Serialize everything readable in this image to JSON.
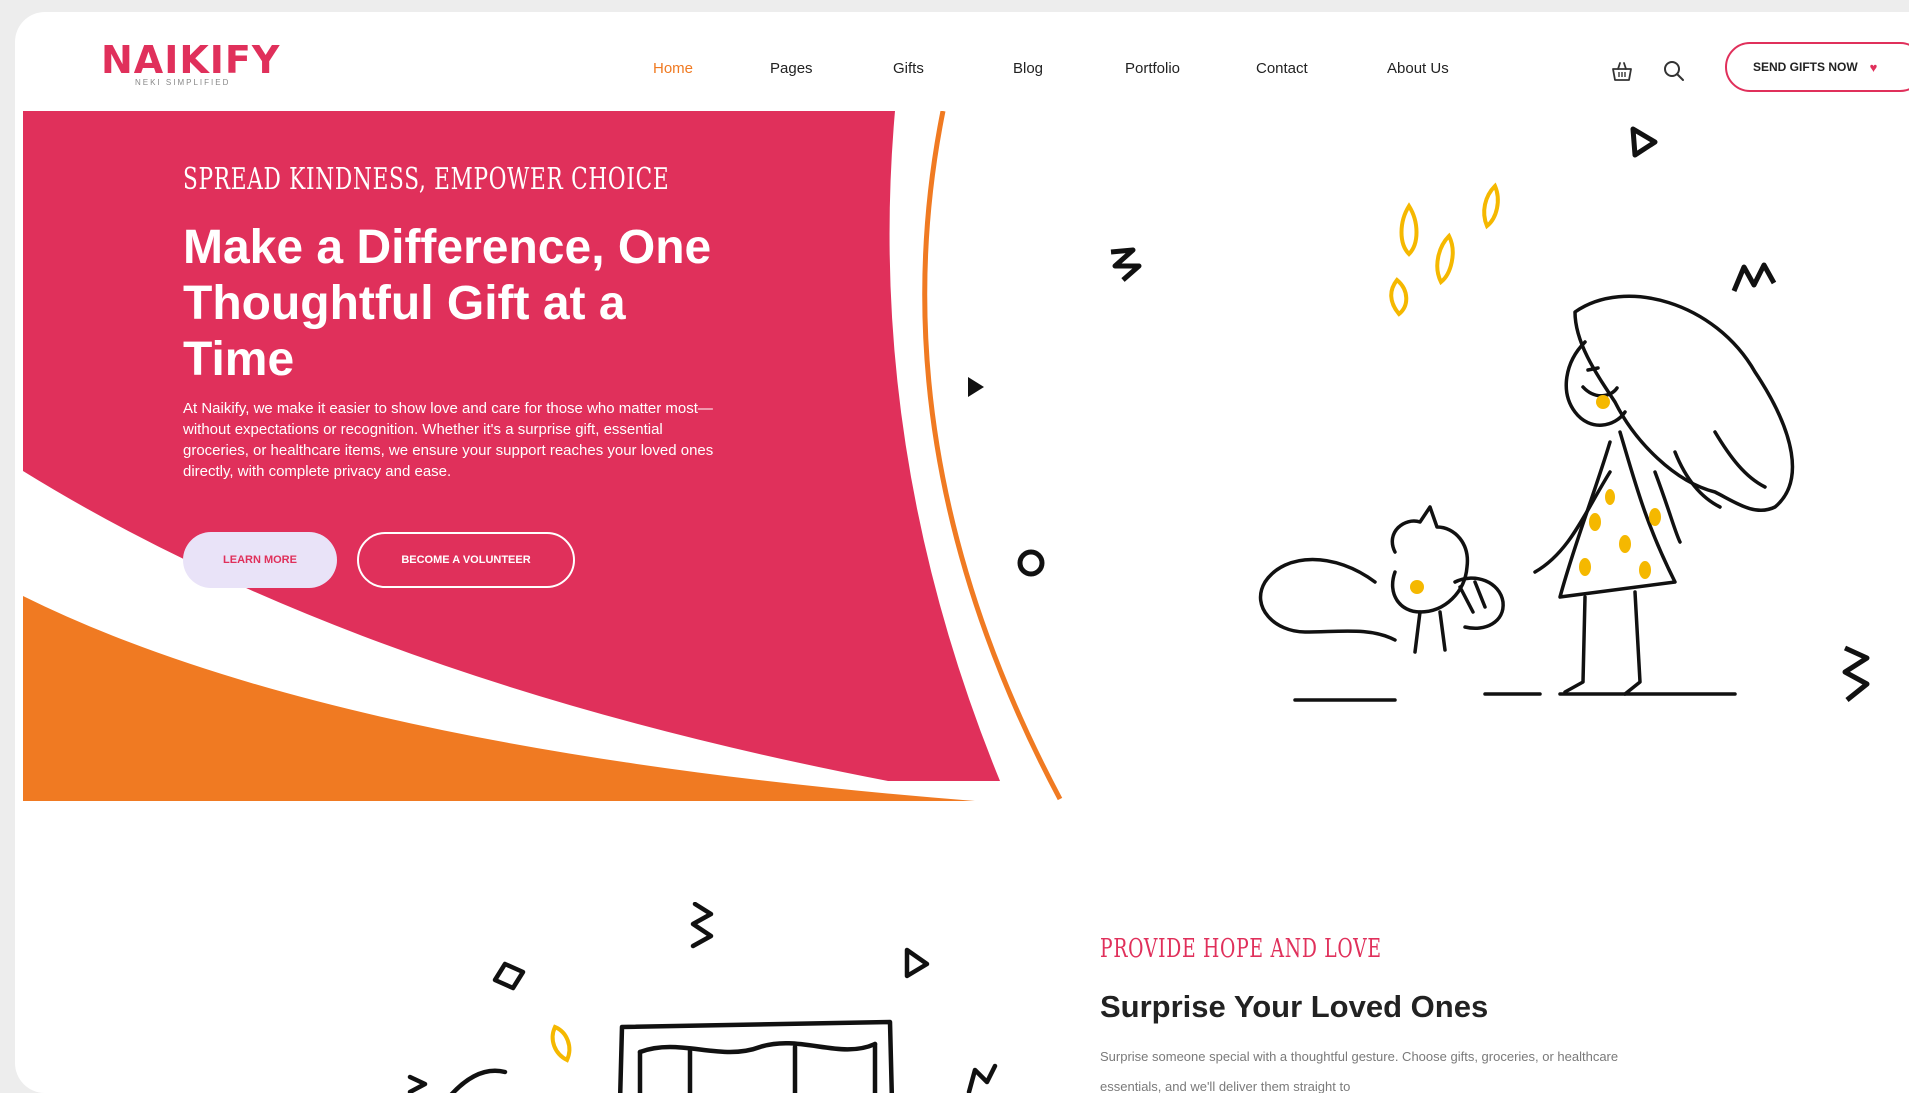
{
  "brand": {
    "name": "NAIKIFY",
    "tagline": "NEKI SIMPLIFIED",
    "primary_color": "#e0305b",
    "accent_color": "#f07a22"
  },
  "nav": {
    "items": [
      {
        "label": "Home",
        "active": true
      },
      {
        "label": "Pages"
      },
      {
        "label": "Gifts"
      },
      {
        "label": "Blog"
      },
      {
        "label": "Portfolio"
      },
      {
        "label": "Contact"
      },
      {
        "label": "About Us"
      }
    ]
  },
  "header": {
    "icons": [
      "basket-icon",
      "search-icon"
    ],
    "cta_label": "SEND GIFTS NOW",
    "cta_icon": "heart-icon"
  },
  "hero": {
    "eyebrow": "SPREAD KINDNESS, EMPOWER CHOICE",
    "title": "Make a Difference, One Thoughtful Gift at a Time",
    "description": "At Naikify, we make it easier to show love and care for those who matter most—without expectations or recognition. Whether it's a surprise gift, essential groceries, or healthcare items, we ensure your support reaches your loved ones directly, with complete privacy and ease.",
    "primary_button": "LEARN MORE",
    "secondary_button": "BECOME A VOLUNTEER",
    "illustration": "girl-and-squirrel-illustration"
  },
  "section2": {
    "eyebrow": "PROVIDE HOPE AND LOVE",
    "title": "Surprise Your Loved Ones",
    "description": "Surprise someone special with a thoughtful gesture. Choose gifts, groceries, or healthcare essentials, and we'll deliver them straight to",
    "illustration": "window-doodle-illustration"
  }
}
